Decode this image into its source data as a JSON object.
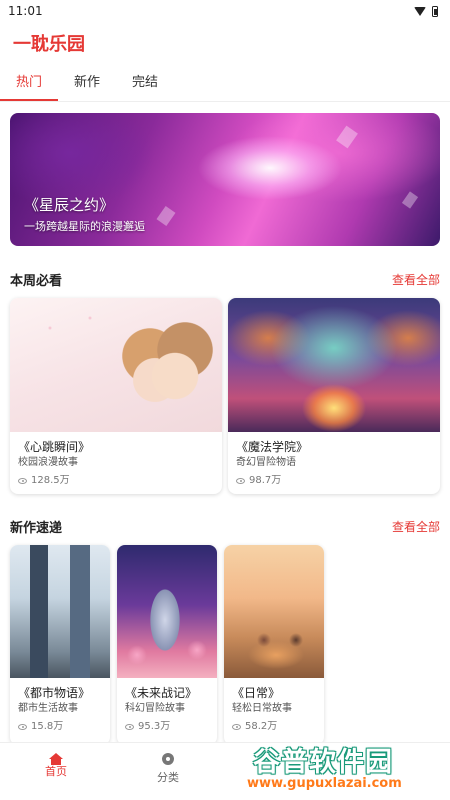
{
  "status_bar": {
    "time": "11:01"
  },
  "app": {
    "title": "一耽乐园"
  },
  "tabs": [
    {
      "label": "热门",
      "active": true
    },
    {
      "label": "新作",
      "active": false
    },
    {
      "label": "完结",
      "active": false
    }
  ],
  "banner": {
    "title": "《星辰之约》",
    "subtitle": "一场跨越星际的浪漫邂逅"
  },
  "weekly": {
    "title": "本周必看",
    "see_all": "查看全部",
    "items": [
      {
        "title": "《心跳瞬间》",
        "genre": "校园浪漫故事",
        "views": "128.5万"
      },
      {
        "title": "《魔法学院》",
        "genre": "奇幻冒险物语",
        "views": "98.7万"
      }
    ]
  },
  "new_releases": {
    "title": "新作速递",
    "see_all": "查看全部",
    "items": [
      {
        "title": "《都市物语》",
        "genre": "都市生活故事",
        "views": "15.8万"
      },
      {
        "title": "《未来战记》",
        "genre": "科幻冒险故事",
        "views": "95.3万"
      },
      {
        "title": "《日常》",
        "genre": "轻松日常故事",
        "views": "58.2万"
      }
    ]
  },
  "bottom_nav": [
    {
      "label": "首页",
      "icon": "home-icon",
      "active": true
    },
    {
      "label": "分类",
      "icon": "compass-icon",
      "active": false
    }
  ],
  "watermark": {
    "name": "谷普软件园",
    "url": "www.gupuxlazai.com"
  },
  "colors": {
    "accent": "#e53935",
    "text": "#222222",
    "muted": "#777777"
  }
}
